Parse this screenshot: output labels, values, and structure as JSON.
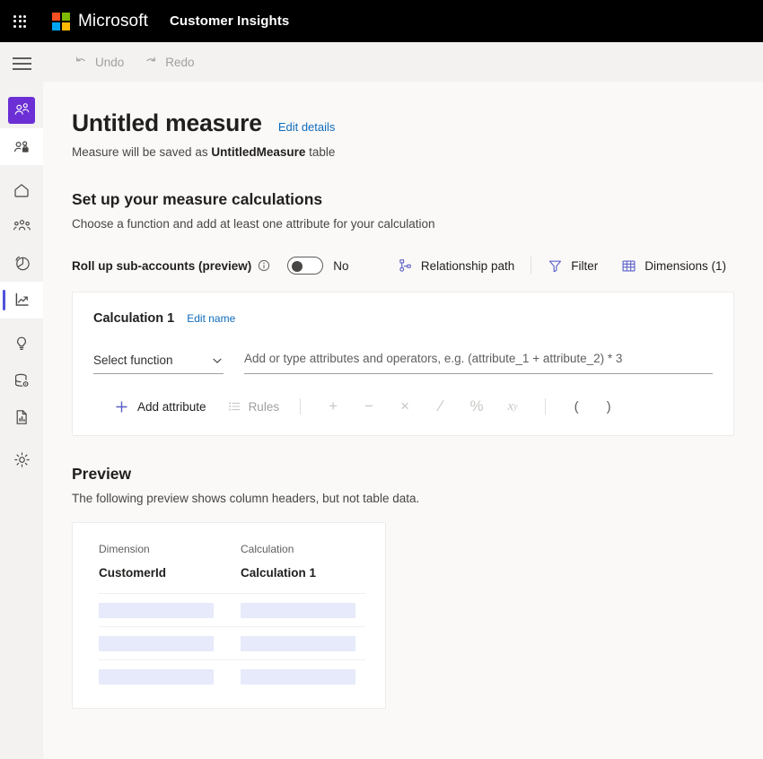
{
  "suite_bar": {
    "waffle_icon": "waffle-grid-icon",
    "brand": "Microsoft",
    "app_name": "Customer Insights",
    "logo_colors": [
      "#f25022",
      "#7fba00",
      "#00a4ef",
      "#ffb900"
    ]
  },
  "command_bar": {
    "undo_label": "Undo",
    "undo_icon": "undo-arrow-icon",
    "redo_label": "Redo",
    "redo_icon": "redo-arrow-icon"
  },
  "rail": {
    "menu_icon": "hamburger-menu-icon",
    "items": [
      {
        "name": "customers-profiles",
        "icon": "people-profile-icon",
        "state": "chip"
      },
      {
        "name": "customer-card",
        "icon": "person-card-icon",
        "state": "white"
      },
      {
        "name": "home",
        "icon": "home-icon",
        "state": "normal"
      },
      {
        "name": "segments",
        "icon": "people-group-icon",
        "state": "normal"
      },
      {
        "name": "analytics-pie",
        "icon": "pie-chart-icon",
        "state": "normal"
      },
      {
        "name": "measures",
        "icon": "line-chart-icon",
        "state": "active"
      },
      {
        "name": "insights",
        "icon": "lightbulb-icon",
        "state": "normal"
      },
      {
        "name": "data-settings",
        "icon": "database-gear-icon",
        "state": "normal"
      },
      {
        "name": "reports",
        "icon": "report-document-icon",
        "state": "normal"
      },
      {
        "name": "settings",
        "icon": "gear-icon",
        "state": "normal"
      }
    ]
  },
  "page": {
    "title": "Untitled measure",
    "edit_details_label": "Edit details",
    "subtitle_pre": "Measure will be saved as ",
    "subtitle_table": "UntitledMeasure",
    "subtitle_post": " table"
  },
  "setup": {
    "heading": "Set up your measure calculations",
    "description": "Choose a function and add at least one attribute for your calculation"
  },
  "rollup": {
    "label": "Roll up sub-accounts (preview)",
    "info_icon": "info-circle-icon",
    "toggle_state": "off",
    "toggle_value": "No"
  },
  "toolbar": {
    "relationship_path_label": "Relationship path",
    "relationship_path_icon": "relationship-path-icon",
    "filter_label": "Filter",
    "filter_icon": "filter-funnel-icon",
    "dimensions_label": "Dimensions (1)",
    "dimensions_icon": "table-grid-icon"
  },
  "calculation": {
    "name": "Calculation 1",
    "edit_name_label": "Edit name",
    "function_select_value": "Select function",
    "function_chevron_icon": "chevron-down-icon",
    "expression_placeholder": "Add or type attributes and operators, e.g. (attribute_1 + attribute_2) * 3",
    "expression_value": "",
    "add_attribute_label": "Add attribute",
    "add_attribute_icon": "plus-icon",
    "rules_label": "Rules",
    "rules_icon": "bulleted-list-icon",
    "operators": [
      {
        "name": "plus",
        "glyph": "+"
      },
      {
        "name": "minus",
        "glyph": "−"
      },
      {
        "name": "multiply",
        "glyph": "×"
      },
      {
        "name": "divide",
        "glyph": "∕"
      },
      {
        "name": "percent",
        "glyph": "%"
      },
      {
        "name": "power",
        "glyph": "x"
      }
    ],
    "power_exponent": "y",
    "paren_open": "(",
    "paren_close": ")"
  },
  "preview": {
    "heading": "Preview",
    "description": "The following preview shows column headers, but not table data.",
    "columns": [
      {
        "sublabel": "Dimension",
        "header": "CustomerId"
      },
      {
        "sublabel": "Calculation",
        "header": "Calculation 1"
      }
    ],
    "placeholder_row_count": 3
  },
  "colors": {
    "accent_purple": "#6b2fd5",
    "active_indicator": "#4f52d9",
    "link_blue": "#0f6cbd",
    "icon_blue": "#5b5fc7",
    "page_bg": "#faf9f8",
    "chrome_bg": "#f3f2f1",
    "placeholder_bar": "#e6eafa"
  }
}
